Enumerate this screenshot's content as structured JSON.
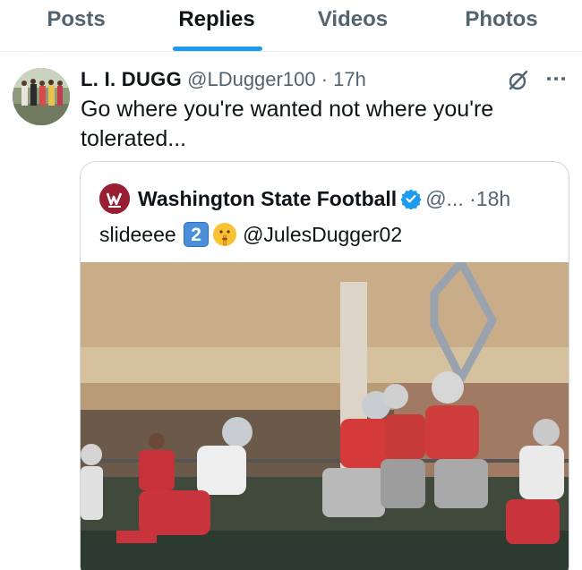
{
  "tabs": [
    {
      "label": "Posts",
      "active": false
    },
    {
      "label": "Replies",
      "active": true
    },
    {
      "label": "Videos",
      "active": false
    },
    {
      "label": "Photos",
      "active": false
    }
  ],
  "colors": {
    "accent": "#1d9bf0",
    "text": "#0f1419",
    "muted": "#536471",
    "wsu_crimson": "#981e32"
  },
  "post": {
    "display_name": "L. I. DUGG",
    "handle": "@LDugger100",
    "separator": "·",
    "time": "17h",
    "text": "Go where you're wanted not where you're tolerated...",
    "icons": [
      "grok-icon",
      "more-icon"
    ]
  },
  "quote": {
    "display_name": "Washington State Football",
    "verified": true,
    "handle": "@...",
    "separator": "·",
    "time": "18h",
    "text_before": "slideeee",
    "keycap": "2",
    "emoji": "shushing-face",
    "mention": "@JulesDugger02"
  }
}
